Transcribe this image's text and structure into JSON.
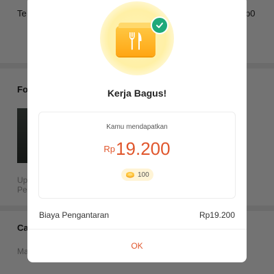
{
  "background": {
    "row1_label": "Te",
    "row1_value": "p0",
    "section2_title": "Fo",
    "section2_line1": "Up",
    "section2_line2": "Pe",
    "section3_title": "Ca",
    "section3_line1": "Ma"
  },
  "modal": {
    "title": "Kerja Bagus!",
    "earnings": {
      "label": "Kamu mendapatkan",
      "currency": "Rp",
      "amount": "19.200",
      "points": "100"
    },
    "fee": {
      "label": "Biaya Pengantaran",
      "value": "Rp19.200"
    },
    "ok_label": "OK"
  },
  "icons": {
    "hero": "cutlery-icon",
    "badge": "check-icon",
    "points": "coin-icon"
  },
  "colors": {
    "accent": "#e0562c",
    "badge": "#1fa97a",
    "hero_orange": "#ffa614",
    "glow": "#fff3b6"
  }
}
